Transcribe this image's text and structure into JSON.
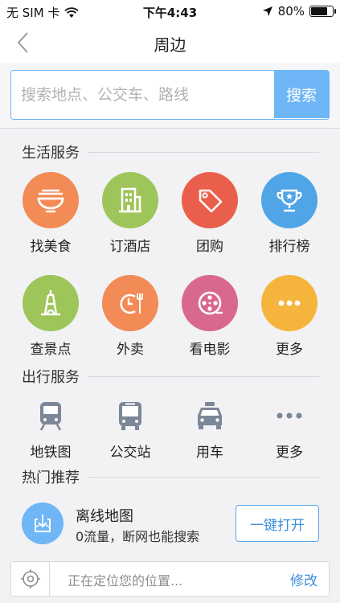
{
  "status_bar": {
    "carrier": "无 SIM 卡",
    "time": "下午4:43",
    "battery": "80%",
    "battery_level": 0.8
  },
  "nav": {
    "back_icon": "chevron-left-icon",
    "title": "周边"
  },
  "search": {
    "placeholder": "搜索地点、公交车、路线",
    "button": "搜索",
    "accent": "#6eb6f6"
  },
  "life_services": {
    "heading": "生活服务",
    "items": [
      {
        "label": "找美食",
        "icon": "noodle-bowl-icon",
        "color": "#f28b55"
      },
      {
        "label": "订酒店",
        "icon": "hotel-building-icon",
        "color": "#9ec55a"
      },
      {
        "label": "团购",
        "icon": "price-tag-icon",
        "color": "#ea5f4b"
      },
      {
        "label": "排行榜",
        "icon": "trophy-icon",
        "color": "#4fa5e5"
      },
      {
        "label": "查景点",
        "icon": "tower-icon",
        "color": "#9ec55a"
      },
      {
        "label": "外卖",
        "icon": "clock-fork-icon",
        "color": "#f28b55"
      },
      {
        "label": "看电影",
        "icon": "film-reel-icon",
        "color": "#d9688f"
      },
      {
        "label": "更多",
        "icon": "more-dots-icon",
        "color": "#f5b53d"
      }
    ]
  },
  "travel_services": {
    "heading": "出行服务",
    "items": [
      {
        "label": "地铁图",
        "icon": "subway-icon"
      },
      {
        "label": "公交站",
        "icon": "bus-icon"
      },
      {
        "label": "用车",
        "icon": "taxi-icon"
      },
      {
        "label": "更多",
        "icon": "more-dots-icon"
      }
    ]
  },
  "hot": {
    "heading": "热门推荐",
    "title": "离线地图",
    "subtitle": "0流量，断网也能搜索",
    "button": "一键打开"
  },
  "location": {
    "text": "正在定位您的位置...",
    "edit": "修改"
  }
}
